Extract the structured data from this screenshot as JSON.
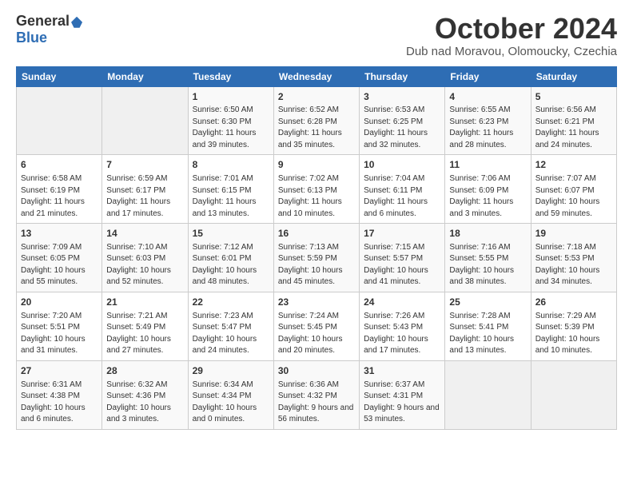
{
  "header": {
    "logo_general": "General",
    "logo_blue": "Blue",
    "month_title": "October 2024",
    "subtitle": "Dub nad Moravou, Olomoucky, Czechia"
  },
  "calendar": {
    "days_of_week": [
      "Sunday",
      "Monday",
      "Tuesday",
      "Wednesday",
      "Thursday",
      "Friday",
      "Saturday"
    ],
    "weeks": [
      [
        {
          "day": "",
          "info": ""
        },
        {
          "day": "",
          "info": ""
        },
        {
          "day": "1",
          "info": "Sunrise: 6:50 AM\nSunset: 6:30 PM\nDaylight: 11 hours and 39 minutes."
        },
        {
          "day": "2",
          "info": "Sunrise: 6:52 AM\nSunset: 6:28 PM\nDaylight: 11 hours and 35 minutes."
        },
        {
          "day": "3",
          "info": "Sunrise: 6:53 AM\nSunset: 6:25 PM\nDaylight: 11 hours and 32 minutes."
        },
        {
          "day": "4",
          "info": "Sunrise: 6:55 AM\nSunset: 6:23 PM\nDaylight: 11 hours and 28 minutes."
        },
        {
          "day": "5",
          "info": "Sunrise: 6:56 AM\nSunset: 6:21 PM\nDaylight: 11 hours and 24 minutes."
        }
      ],
      [
        {
          "day": "6",
          "info": "Sunrise: 6:58 AM\nSunset: 6:19 PM\nDaylight: 11 hours and 21 minutes."
        },
        {
          "day": "7",
          "info": "Sunrise: 6:59 AM\nSunset: 6:17 PM\nDaylight: 11 hours and 17 minutes."
        },
        {
          "day": "8",
          "info": "Sunrise: 7:01 AM\nSunset: 6:15 PM\nDaylight: 11 hours and 13 minutes."
        },
        {
          "day": "9",
          "info": "Sunrise: 7:02 AM\nSunset: 6:13 PM\nDaylight: 11 hours and 10 minutes."
        },
        {
          "day": "10",
          "info": "Sunrise: 7:04 AM\nSunset: 6:11 PM\nDaylight: 11 hours and 6 minutes."
        },
        {
          "day": "11",
          "info": "Sunrise: 7:06 AM\nSunset: 6:09 PM\nDaylight: 11 hours and 3 minutes."
        },
        {
          "day": "12",
          "info": "Sunrise: 7:07 AM\nSunset: 6:07 PM\nDaylight: 10 hours and 59 minutes."
        }
      ],
      [
        {
          "day": "13",
          "info": "Sunrise: 7:09 AM\nSunset: 6:05 PM\nDaylight: 10 hours and 55 minutes."
        },
        {
          "day": "14",
          "info": "Sunrise: 7:10 AM\nSunset: 6:03 PM\nDaylight: 10 hours and 52 minutes."
        },
        {
          "day": "15",
          "info": "Sunrise: 7:12 AM\nSunset: 6:01 PM\nDaylight: 10 hours and 48 minutes."
        },
        {
          "day": "16",
          "info": "Sunrise: 7:13 AM\nSunset: 5:59 PM\nDaylight: 10 hours and 45 minutes."
        },
        {
          "day": "17",
          "info": "Sunrise: 7:15 AM\nSunset: 5:57 PM\nDaylight: 10 hours and 41 minutes."
        },
        {
          "day": "18",
          "info": "Sunrise: 7:16 AM\nSunset: 5:55 PM\nDaylight: 10 hours and 38 minutes."
        },
        {
          "day": "19",
          "info": "Sunrise: 7:18 AM\nSunset: 5:53 PM\nDaylight: 10 hours and 34 minutes."
        }
      ],
      [
        {
          "day": "20",
          "info": "Sunrise: 7:20 AM\nSunset: 5:51 PM\nDaylight: 10 hours and 31 minutes."
        },
        {
          "day": "21",
          "info": "Sunrise: 7:21 AM\nSunset: 5:49 PM\nDaylight: 10 hours and 27 minutes."
        },
        {
          "day": "22",
          "info": "Sunrise: 7:23 AM\nSunset: 5:47 PM\nDaylight: 10 hours and 24 minutes."
        },
        {
          "day": "23",
          "info": "Sunrise: 7:24 AM\nSunset: 5:45 PM\nDaylight: 10 hours and 20 minutes."
        },
        {
          "day": "24",
          "info": "Sunrise: 7:26 AM\nSunset: 5:43 PM\nDaylight: 10 hours and 17 minutes."
        },
        {
          "day": "25",
          "info": "Sunrise: 7:28 AM\nSunset: 5:41 PM\nDaylight: 10 hours and 13 minutes."
        },
        {
          "day": "26",
          "info": "Sunrise: 7:29 AM\nSunset: 5:39 PM\nDaylight: 10 hours and 10 minutes."
        }
      ],
      [
        {
          "day": "27",
          "info": "Sunrise: 6:31 AM\nSunset: 4:38 PM\nDaylight: 10 hours and 6 minutes."
        },
        {
          "day": "28",
          "info": "Sunrise: 6:32 AM\nSunset: 4:36 PM\nDaylight: 10 hours and 3 minutes."
        },
        {
          "day": "29",
          "info": "Sunrise: 6:34 AM\nSunset: 4:34 PM\nDaylight: 10 hours and 0 minutes."
        },
        {
          "day": "30",
          "info": "Sunrise: 6:36 AM\nSunset: 4:32 PM\nDaylight: 9 hours and 56 minutes."
        },
        {
          "day": "31",
          "info": "Sunrise: 6:37 AM\nSunset: 4:31 PM\nDaylight: 9 hours and 53 minutes."
        },
        {
          "day": "",
          "info": ""
        },
        {
          "day": "",
          "info": ""
        }
      ]
    ]
  }
}
